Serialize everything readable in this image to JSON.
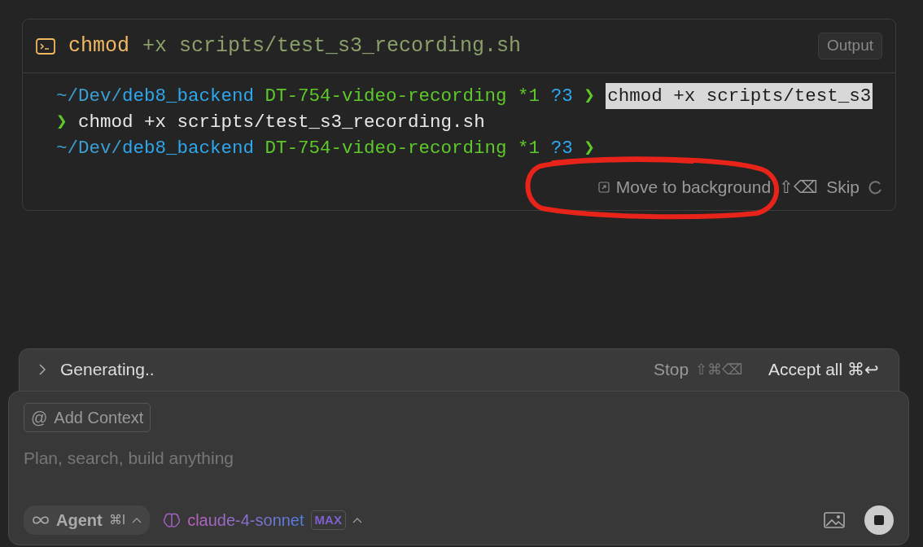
{
  "terminal": {
    "command_name": "chmod",
    "command_args": "+x scripts/test_s3_recording.sh",
    "output_button": "Output",
    "lines": [
      [
        {
          "kind": "path",
          "text": "~/Dev/"
        },
        {
          "kind": "dir",
          "text": "deb8_backend"
        },
        {
          "kind": "branch",
          "text": "DT-754-video-recording"
        },
        {
          "kind": "branch",
          "text": "*1"
        },
        {
          "kind": "dir",
          "text": "?3"
        },
        {
          "kind": "prompt",
          "text": "❯"
        },
        {
          "kind": "highlight",
          "text": "chmod +x scripts/test_s3"
        }
      ],
      [
        {
          "kind": "prompt",
          "text": "❯"
        },
        {
          "kind": "command",
          "text": "chmod +x scripts/test_s3_recording.sh"
        }
      ],
      [
        {
          "kind": "path",
          "text": "~/Dev/"
        },
        {
          "kind": "dir",
          "text": "deb8_backend"
        },
        {
          "kind": "branch",
          "text": "DT-754-video-recording"
        },
        {
          "kind": "branch",
          "text": "*1"
        },
        {
          "kind": "dir",
          "text": "?3"
        },
        {
          "kind": "prompt",
          "text": "❯"
        }
      ]
    ],
    "move_button": "Move to background",
    "skip_shortcut": "⇧⌫",
    "skip_button": "Skip"
  },
  "generating": {
    "expanded": false,
    "label": "Generating..",
    "stop_button": "Stop",
    "stop_shortcut": "⇧⌘⌫",
    "accept_button": "Accept all",
    "accept_shortcut": "⌘↩"
  },
  "composer": {
    "add_context": "Add Context",
    "at_sign": "@",
    "placeholder": "Plan, search, build anything",
    "mode": "Agent",
    "mode_shortcut": "⌘I",
    "model": "claude-4-sonnet",
    "model_badge": "MAX"
  }
}
